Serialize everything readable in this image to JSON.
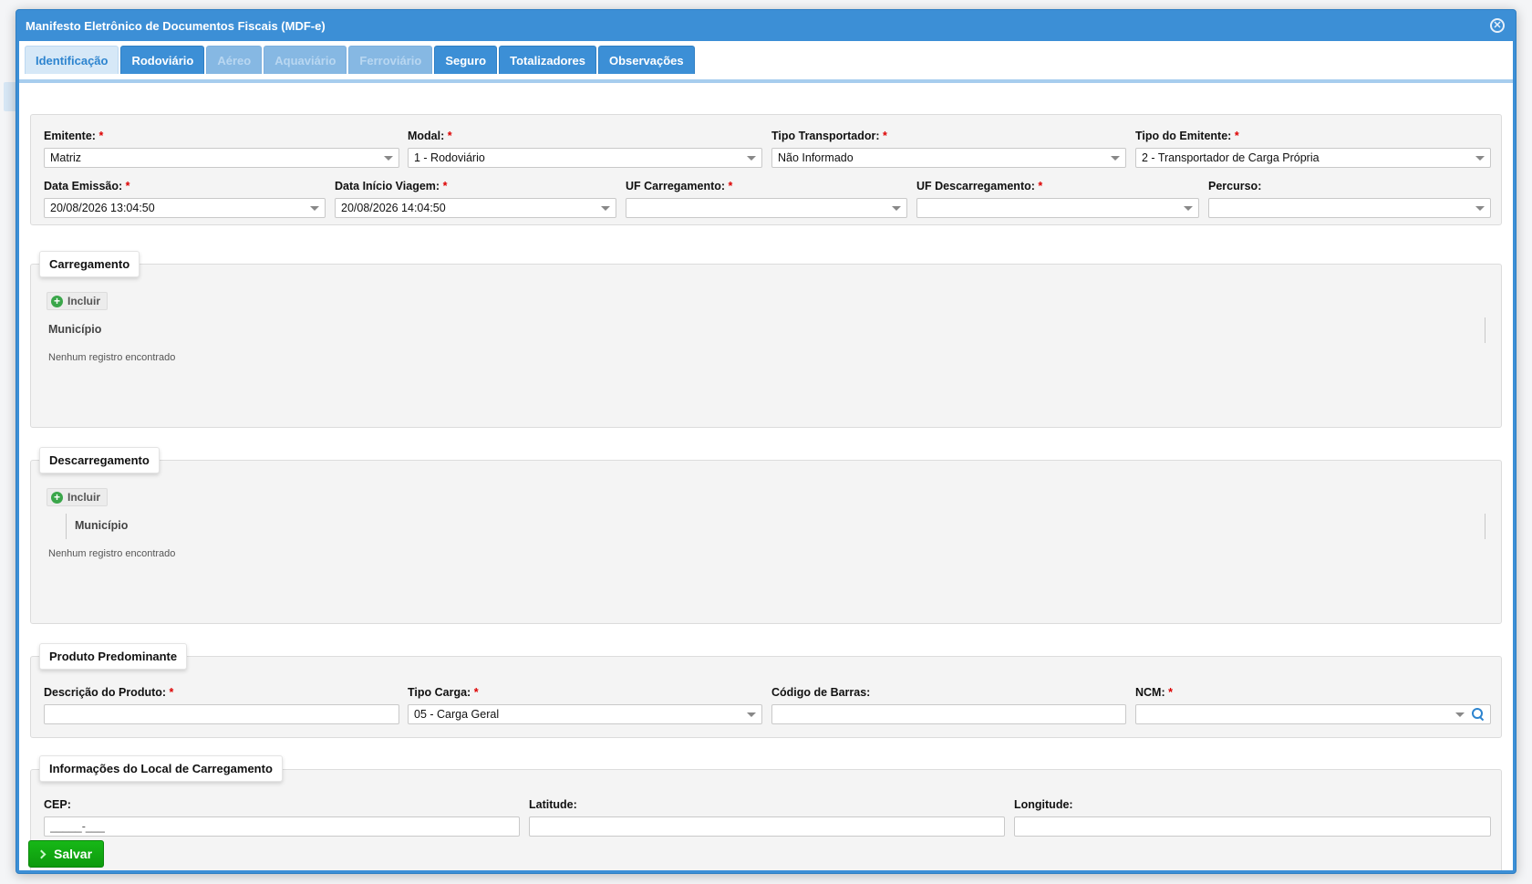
{
  "dialog": {
    "title": "Manifesto Eletrônico de Documentos Fiscais (MDF-e)",
    "close_icon": "close-icon"
  },
  "tabs": [
    {
      "label": "Identificação",
      "state": "active"
    },
    {
      "label": "Rodoviário",
      "state": "enabled"
    },
    {
      "label": "Aéreo",
      "state": "disabled"
    },
    {
      "label": "Aquaviário",
      "state": "disabled"
    },
    {
      "label": "Ferroviário",
      "state": "disabled"
    },
    {
      "label": "Seguro",
      "state": "enabled"
    },
    {
      "label": "Totalizadores",
      "state": "enabled"
    },
    {
      "label": "Observações",
      "state": "enabled"
    }
  ],
  "required_marker": "*",
  "ident": {
    "emitente": {
      "label": "Emitente:",
      "value": "Matriz"
    },
    "modal": {
      "label": "Modal:",
      "value": "1 - Rodoviário"
    },
    "tipo_transportador": {
      "label": "Tipo Transportador:",
      "value": "Não Informado"
    },
    "tipo_emitente": {
      "label": "Tipo do Emitente:",
      "value": "2 - Transportador de Carga Própria"
    },
    "data_emissao": {
      "label": "Data Emissão:",
      "value": "20/08/2026 13:04:50"
    },
    "data_inicio": {
      "label": "Data Início Viagem:",
      "value": "20/08/2026 14:04:50"
    },
    "uf_carregamento": {
      "label": "UF Carregamento:",
      "value": ""
    },
    "uf_descarregamento": {
      "label": "UF Descarregamento:",
      "value": ""
    },
    "percurso": {
      "label": "Percurso:",
      "value": ""
    }
  },
  "carregamento": {
    "legend": "Carregamento",
    "add_label": "Incluir",
    "column": "Município",
    "empty": "Nenhum registro encontrado"
  },
  "descarregamento": {
    "legend": "Descarregamento",
    "add_label": "Incluir",
    "column": "Município",
    "empty": "Nenhum registro encontrado"
  },
  "produto": {
    "legend": "Produto Predominante",
    "descricao": {
      "label": "Descrição do Produto:",
      "value": ""
    },
    "tipo_carga": {
      "label": "Tipo Carga:",
      "value": "05 - Carga Geral"
    },
    "codigo_barras": {
      "label": "Código de Barras:",
      "value": ""
    },
    "ncm": {
      "label": "NCM:",
      "value": ""
    }
  },
  "local_carregamento": {
    "legend": "Informações do Local de Carregamento",
    "cep": {
      "label": "CEP:",
      "value": "_____-___"
    },
    "latitude": {
      "label": "Latitude:",
      "value": ""
    },
    "longitude": {
      "label": "Longitude:",
      "value": ""
    }
  },
  "footer": {
    "save_label": "Salvar"
  },
  "colors": {
    "header_blue": "#3c8fd6",
    "save_green": "#12a812",
    "required_red": "#dd0000"
  }
}
